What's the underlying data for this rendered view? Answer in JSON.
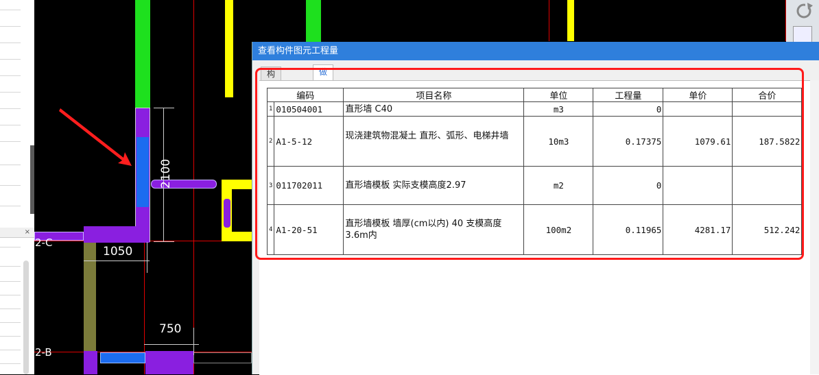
{
  "cad": {
    "dim_2100": "2100",
    "dim_1050": "1050",
    "dim_750": "750",
    "axis_2c": "2-C",
    "axis_2b": "2-B"
  },
  "dialog": {
    "title": "查看构件图元工程量",
    "tabs": [
      {
        "label": "构件工程量"
      },
      {
        "label": "做法工程量"
      }
    ],
    "columns": [
      "编码",
      "项目名称",
      "单位",
      "工程量",
      "单价",
      "合价"
    ],
    "rows": [
      {
        "num": "1",
        "code": "010504001",
        "name": "直形墙 C40",
        "unit": "m3",
        "qty": "0",
        "price": "",
        "total": ""
      },
      {
        "num": "2",
        "code": "A1-5-12",
        "name": "现浇建筑物混凝土 直形、弧形、电梯井墙",
        "unit": "10m3",
        "qty": "0.17375",
        "price": "1079.61",
        "total": "187.5822"
      },
      {
        "num": "3",
        "code": "011702011",
        "name": "直形墙模板 实际支模高度2.97",
        "unit": "m2",
        "qty": "0",
        "price": "",
        "total": ""
      },
      {
        "num": "4",
        "code": "A1-20-51",
        "name": "直形墙模板 墙厚(cm以内) 40 支模高度3.6m内",
        "unit": "100m2",
        "qty": "0.11965",
        "price": "4281.17",
        "total": "512.242"
      }
    ]
  },
  "left_panel": {
    "close_glyph": "×"
  },
  "colors": {
    "dialog_title_bg": "#2f7fdc",
    "highlight": "#ff1a1a",
    "wall_green": "#1ee01e",
    "wall_yellow": "#ffff00",
    "wall_purple": "#8a1fe0",
    "wall_blue": "#1c6cf0"
  },
  "icons": [
    "refresh-icon",
    "toolbar-icon",
    "arrow-annotation-icon",
    "close-icon"
  ]
}
